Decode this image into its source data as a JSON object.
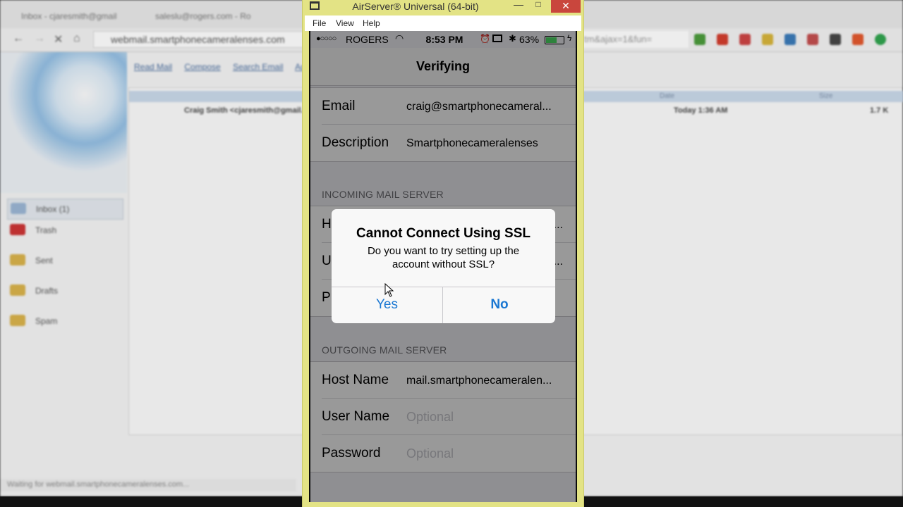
{
  "background_browser": {
    "tabs": [
      "Inbox - cjaresmith@gmail",
      "saleslu@rogers.com - Ro"
    ],
    "url": "webmail.smartphonecameralenses.com",
    "url_suffix": "tm&ajax=1&fun=",
    "mail_menu": [
      "Read Mail",
      "Compose",
      "Search Email",
      "Addr"
    ],
    "folders": [
      "Inbox (1)",
      "Trash",
      "Sent",
      "Drafts",
      "Spam"
    ],
    "list_header": {
      "date": "Date",
      "size": "Size"
    },
    "message_row": {
      "from": "Craig Smith <cjaresmith@gmail.c",
      "date": "Today 1:36 AM",
      "size": "1.7 K"
    },
    "status_text": "Waiting for webmail.smartphonecameralenses.com..."
  },
  "window": {
    "title": "AirServer® Universal (64-bit)",
    "controls": {
      "minimize": "—",
      "maximize": "□",
      "close": "✕"
    },
    "menu": [
      "File",
      "View",
      "Help"
    ]
  },
  "phone": {
    "status_bar": {
      "signal": "●○○○○",
      "carrier": "ROGERS",
      "time": "8:53 PM",
      "battery_pct": "63%",
      "battery_level": 0.63
    },
    "nav_title": "Verifying",
    "account": [
      {
        "label": "Email",
        "value": "craig@smartphonecameral..."
      },
      {
        "label": "Description",
        "value": "Smartphonecameralenses"
      }
    ],
    "incoming_header": "INCOMING MAIL SERVER",
    "incoming_rows": [
      {
        "label": "H",
        "value": "..."
      },
      {
        "label": "U",
        "value": "..."
      },
      {
        "label": "P",
        "value": ""
      }
    ],
    "outgoing_header": "OUTGOING MAIL SERVER",
    "outgoing": [
      {
        "label": "Host Name",
        "value": "mail.smartphonecameralen..."
      },
      {
        "label": "User Name",
        "placeholder": "Optional"
      },
      {
        "label": "Password",
        "placeholder": "Optional"
      }
    ]
  },
  "alert": {
    "title": "Cannot Connect Using SSL",
    "message": "Do you want to try setting up the account without SSL?",
    "yes_label": "Yes",
    "no_label": "No"
  },
  "colors": {
    "airserver_frame": "#e3e385",
    "ios_blue": "#1a77d2",
    "close_red": "#c9463d",
    "battery_green": "#4cd964"
  }
}
